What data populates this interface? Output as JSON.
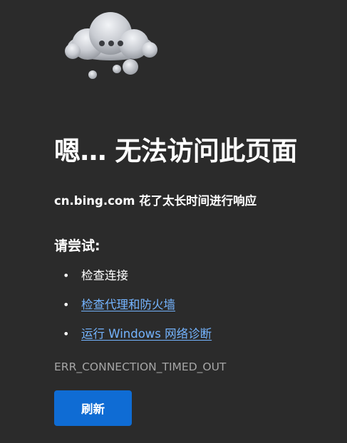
{
  "error_page": {
    "illustration_icon": "cloud-with-speech-dots-icon",
    "title": "嗯… 无法访问此页面",
    "subtitle": "cn.bing.com 花了太长时间进行响应",
    "try_heading": "请尝试:",
    "suggestions": [
      {
        "label": "检查连接",
        "is_link": false
      },
      {
        "label": "检查代理和防火墙",
        "is_link": true
      },
      {
        "label": "运行 Windows 网络诊断",
        "is_link": true
      }
    ],
    "error_code": "ERR_CONNECTION_TIMED_OUT",
    "refresh_label": "刷新"
  },
  "colors": {
    "background": "#2b2b2b",
    "text": "#ffffff",
    "link": "#74b4ff",
    "error_code": "#a6a6a6",
    "button": "#0f6cd4"
  }
}
